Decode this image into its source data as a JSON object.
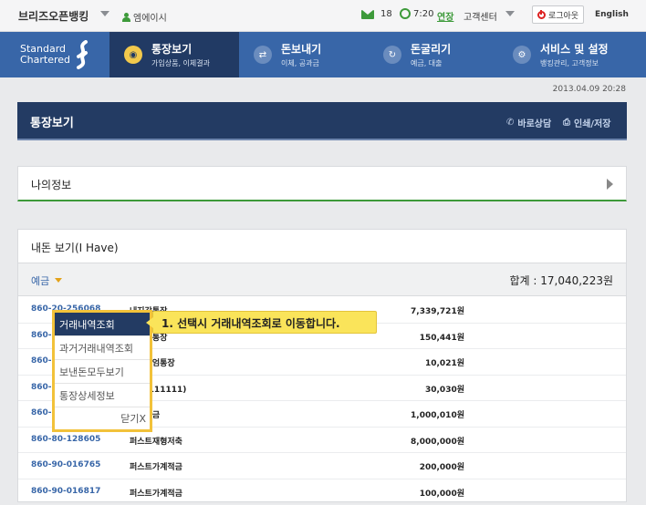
{
  "topbar": {
    "brand": "브리즈오픈뱅킹",
    "user": "엠에이시",
    "mail_count": "18",
    "time": "7:20",
    "extend": "연장",
    "customer_center": "고객센터",
    "logout": "로그아웃",
    "language": "English"
  },
  "nav": {
    "logo_line1": "Standard",
    "logo_line2": "Chartered",
    "items": [
      {
        "title": "통장보기",
        "sub": "가입상품, 이체결과"
      },
      {
        "title": "돈보내기",
        "sub": "이체, 공과금"
      },
      {
        "title": "돈굴리기",
        "sub": "예금, 대출"
      },
      {
        "title": "서비스 및 설정",
        "sub": "뱅킹관리, 고객정보"
      }
    ]
  },
  "datetime": "2013.04.09 20:28",
  "page": {
    "title": "통장보기",
    "consult": "바로상담",
    "print": "인쇄/저장"
  },
  "myinfo": {
    "label": "나의정보"
  },
  "assets": {
    "title": "내돈 보기(I Have)",
    "filter": "예금",
    "total": "합계 : 17,040,223원",
    "rows": [
      {
        "account": "860-20-256068",
        "name": "내지갑통장",
        "amount": "7,339,721원"
      },
      {
        "account": "860-20-******",
        "name": "내지갑통장",
        "amount": "150,441원"
      },
      {
        "account": "860-20-******",
        "name": "프리미엄통장",
        "amount": "10,021원"
      },
      {
        "account": "860-10-******",
        "name": "적금(111111)",
        "amount": "30,030원"
      },
      {
        "account": "860-30-******",
        "name": "정기예금",
        "amount": "1,000,010원"
      },
      {
        "account": "860-80-128605",
        "name": "퍼스트재형저축",
        "amount": "8,000,000원"
      },
      {
        "account": "860-90-016765",
        "name": "퍼스트가계적금",
        "amount": "200,000원"
      },
      {
        "account": "860-90-016817",
        "name": "퍼스트가계적금",
        "amount": "100,000원"
      }
    ]
  },
  "popup": {
    "items": [
      "거래내역조회",
      "과거거래내역조회",
      "보낸돈모두보기",
      "통장상세정보"
    ],
    "close": "닫기X"
  },
  "callout": "1. 선택시 거래내역조회로 이동합니다."
}
